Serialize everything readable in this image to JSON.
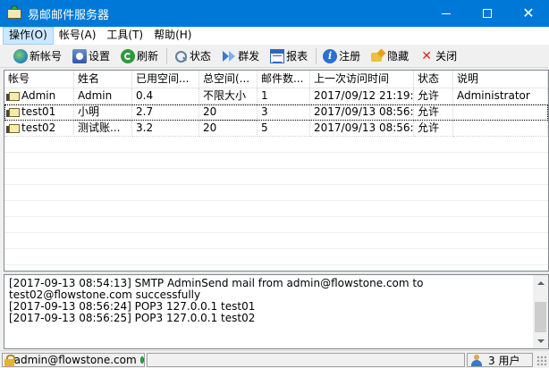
{
  "window": {
    "title": "易邮邮件服务器",
    "close_glyph": "✕"
  },
  "menu": [
    "操作(O)",
    "帐号(A)",
    "工具(T)",
    "帮助(H)"
  ],
  "toolbar": {
    "new_account": "新帐号",
    "settings": "设置",
    "refresh": "刷新",
    "status": "状态",
    "broadcast": "群发",
    "report": "报表",
    "register": "注册",
    "hide": "隐藏",
    "close": "关闭",
    "close_glyph": "✕",
    "info_glyph": "i"
  },
  "accounts": {
    "columns": [
      "帐号",
      "姓名",
      "已用空间...",
      "总空间(...",
      "邮件数...",
      "上一次访问时间",
      "状态",
      "说明"
    ],
    "rows": [
      {
        "account": "Admin",
        "name": "Admin",
        "used": "0.4",
        "total": "不限大小",
        "mails": "1",
        "last_access": "2017/09/12 21:19:53",
        "status": "允许",
        "note": "Administrator"
      },
      {
        "account": "test01",
        "name": "小明",
        "used": "2.7",
        "total": "20",
        "mails": "3",
        "last_access": "2017/09/13 08:56:24",
        "status": "允许",
        "note": ""
      },
      {
        "account": "test02",
        "name": "测试账...",
        "used": "3.2",
        "total": "20",
        "mails": "5",
        "last_access": "2017/09/13 08:56:26",
        "status": "允许",
        "note": ""
      }
    ]
  },
  "log": [
    "[2017-09-13 08:54:13] SMTP AdminSend mail from admin@flowstone.com to test02@flowstone.com successfully",
    "[2017-09-13 08:56:24] POP3 127.0.0.1 test01",
    "[2017-09-13 08:56:25] POP3 127.0.0.1 test02"
  ],
  "statusbar": {
    "user": "admin@flowstone.com",
    "users_online": "3 用户"
  },
  "colors": {
    "titlebar": "#0078d7",
    "menu_active": "#cce8ff"
  }
}
